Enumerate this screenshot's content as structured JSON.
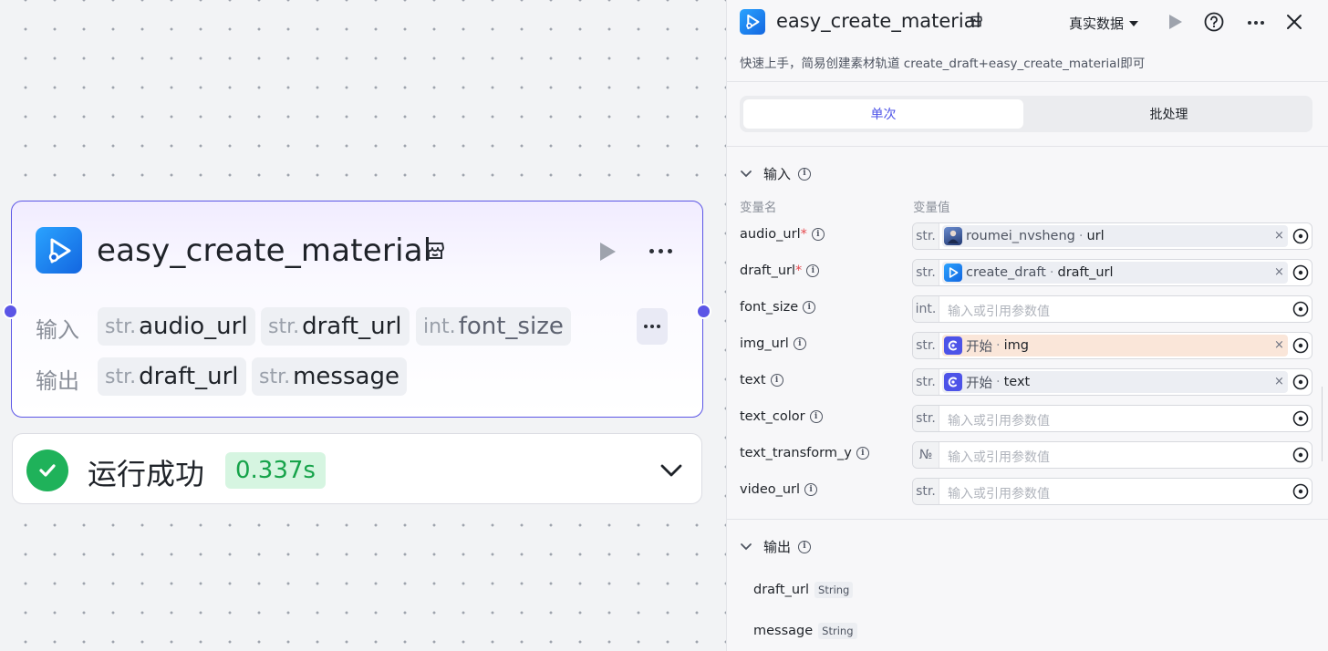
{
  "node": {
    "title": "easy_create_material",
    "input_label": "输入",
    "output_label": "输出",
    "inputs": [
      {
        "type": "str.",
        "name": "audio_url"
      },
      {
        "type": "str.",
        "name": "draft_url"
      },
      {
        "type": "int.",
        "name": "font_size"
      }
    ],
    "outputs": [
      {
        "type": "str.",
        "name": "draft_url"
      },
      {
        "type": "str.",
        "name": "message"
      }
    ],
    "status_text": "运行成功",
    "duration": "0.337s",
    "status_color": "#1fb25a",
    "accent_color": "#5b55e6"
  },
  "panel": {
    "title": "easy_create_material",
    "mode_label": "真实数据",
    "description": "快速上手，简易创建素材轨道 create_draft+easy_create_material即可",
    "tabs": [
      {
        "label": "单次",
        "active": true
      },
      {
        "label": "批处理",
        "active": false
      }
    ],
    "input_section": {
      "title": "输入",
      "col_name": "变量名",
      "col_value": "变量值",
      "placeholder": "输入或引用参数值",
      "fields": [
        {
          "name": "audio_url",
          "required": "*",
          "type": "str.",
          "ref_source": "roumei_nvsheng",
          "ref_field": "url",
          "ref_icon": "avatar-icon"
        },
        {
          "name": "draft_url",
          "required": "*",
          "type": "str.",
          "ref_source": "create_draft",
          "ref_field": "draft_url",
          "ref_icon": "plugin-logo-icon"
        },
        {
          "name": "font_size",
          "type": "int."
        },
        {
          "name": "img_url",
          "type": "str.",
          "ref_source": "开始",
          "ref_field": "img",
          "ref_icon": "start-node-icon"
        },
        {
          "name": "text",
          "type": "str.",
          "ref_source": "开始",
          "ref_field": "text",
          "ref_icon": "start-node-icon"
        },
        {
          "name": "text_color",
          "type": "str."
        },
        {
          "name": "text_transform_y",
          "type": "№"
        },
        {
          "name": "video_url",
          "type": "str."
        }
      ]
    },
    "output_section": {
      "title": "输出",
      "items": [
        {
          "name": "draft_url",
          "type": "String"
        },
        {
          "name": "message",
          "type": "String"
        }
      ]
    },
    "clear_symbol": "×"
  }
}
